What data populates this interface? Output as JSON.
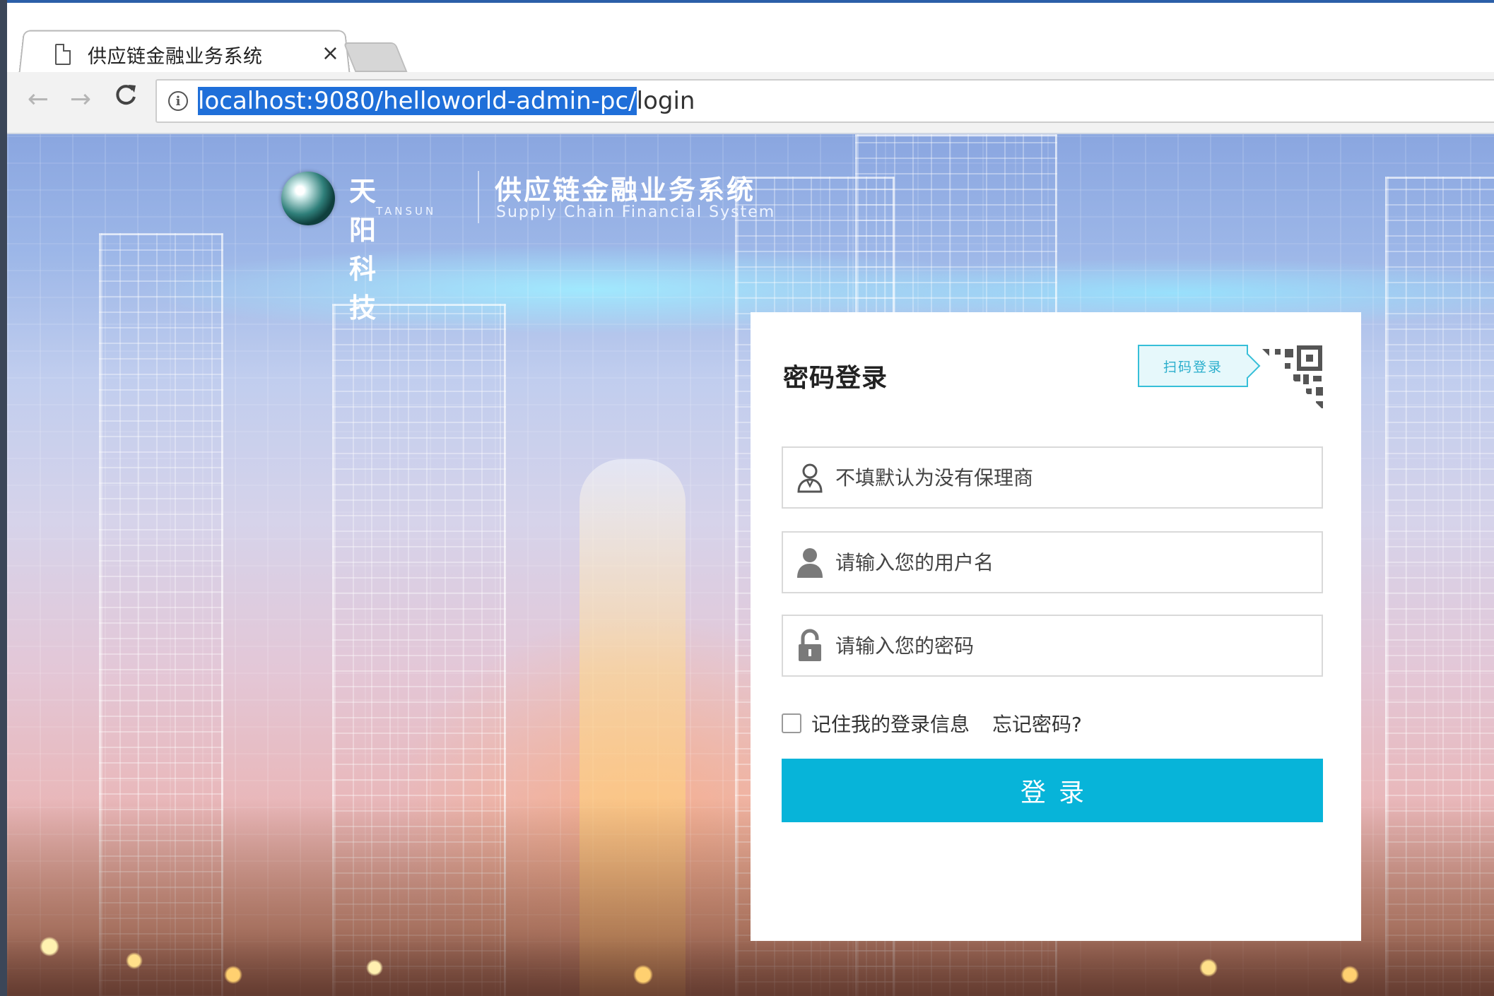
{
  "browser": {
    "tab_title": "供应链金融业务系统",
    "tab_close": "×",
    "nav_back": "←",
    "nav_forward": "→",
    "nav_reload": "C",
    "info_icon": "i",
    "url_selected": "localhost:9080/helloworld-admin-pc/",
    "url_rest": "login"
  },
  "header": {
    "brand_cn": "天阳科技",
    "brand_en": "TANSUN",
    "system_cn": "供应链金融业务系统",
    "system_en": "Supply Chain Financial System"
  },
  "login": {
    "title": "密码登录",
    "scan_login": "扫码登录",
    "factor_placeholder": "不填默认为没有保理商",
    "username_placeholder": "请输入您的用户名",
    "password_placeholder": "请输入您的密码",
    "remember_label": "记住我的登录信息",
    "forgot_label": "忘记密码?",
    "submit_label": "登录",
    "accent_color": "#07b4d9"
  },
  "icons": {
    "tab_page": "page-icon",
    "factor": "user-outline-icon",
    "username": "user-icon",
    "password": "lock-icon",
    "qr": "qr-code-icon"
  }
}
